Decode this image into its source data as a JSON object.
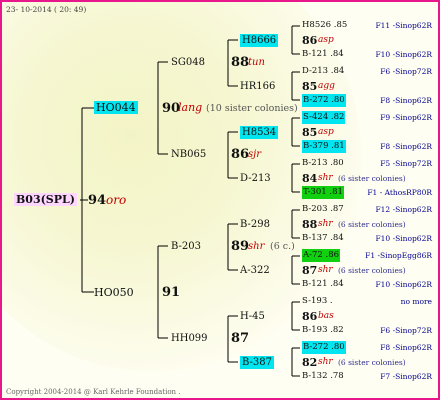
{
  "header": {
    "date": "23- 10-2014 ( 20: 49)",
    "copyright": "Copyright 2004-2014 @ Karl Kehrle Foundation ."
  },
  "root": {
    "id": "B03(SPL)",
    "num": "94",
    "name": "oro"
  },
  "p": [
    {
      "id": "HO044",
      "num": "90",
      "name": "lang",
      "note": "(10 sister colonies)"
    },
    {
      "id": "HO050",
      "num": "91",
      "name": "",
      "note": ""
    }
  ],
  "gp": [
    {
      "id": "SG048",
      "num": "88",
      "name": "tun",
      "note": ""
    },
    {
      "id": "NB065",
      "num": "86",
      "name": "sjr",
      "note": ""
    },
    {
      "id": "B-203",
      "num": "89",
      "name": "shr",
      "note": "(6 c.)"
    },
    {
      "id": "HH099",
      "num": "87",
      "name": "",
      "note": ""
    }
  ],
  "ggp": [
    {
      "id": "H8666"
    },
    {
      "id": "HR166"
    },
    {
      "id": "H8534"
    },
    {
      "id": "D-213"
    },
    {
      "id": "B-298"
    },
    {
      "id": "A-322"
    },
    {
      "id": "H-45"
    },
    {
      "id": "B-387"
    }
  ],
  "g5": [
    {
      "a": "H8526 .85",
      "an": "F11 -Sinop62R",
      "num": "86",
      "name": "asp",
      "note": "",
      "b": "B-121 .84",
      "bn": "F10 -Sinop62R"
    },
    {
      "a": "D-213 .84",
      "an": "F6 -Sinop72R",
      "num": "85",
      "name": "agg",
      "note": "",
      "b": "B-272 .80",
      "bn": "F8 -Sinop62R"
    },
    {
      "a": "S-424 .82",
      "an": "F9 -Sinop62R",
      "num": "85",
      "name": "asp",
      "note": "",
      "b": "B-379 .81",
      "bn": "F8 -Sinop62R"
    },
    {
      "a": "B-213 .80",
      "an": "F5 -Sinop72R",
      "num": "84",
      "name": "shr",
      "note": "(6 sister colonies)",
      "b": "T-301 .81",
      "bn": "F1 - AthosRP80R"
    },
    {
      "a": "B-203 .87",
      "an": "F12 -Sinop62R",
      "num": "88",
      "name": "shr",
      "note": "(6 sister colonies)",
      "b": "B-137 .84",
      "bn": "F10 -Sinop62R"
    },
    {
      "a": "A-72 .86",
      "an": "F1 -SinopEgg86R",
      "num": "87",
      "name": "shr",
      "note": "(6 sister colonies)",
      "b": "B-121 .84",
      "bn": "F10 -Sinop62R"
    },
    {
      "a": "S-193 .",
      "an": "no more",
      "num": "86",
      "name": "bas",
      "note": "",
      "b": "B-193 .82",
      "bn": "F6 -Sinop72R"
    },
    {
      "a": "B-272 .80",
      "an": "F8 -Sinop62R",
      "num": "82",
      "name": "shr",
      "note": "(6 sister colonies)",
      "b": "B-132 .78",
      "bn": "F7 -Sinop62R"
    }
  ],
  "colors": {
    "border": "#e8188c",
    "highlight_cyan": "#00e5ef",
    "highlight_green": "#10d010",
    "root_bg": "#ffd6ff",
    "name_red": "#c00000",
    "note_blue": "#000090"
  }
}
